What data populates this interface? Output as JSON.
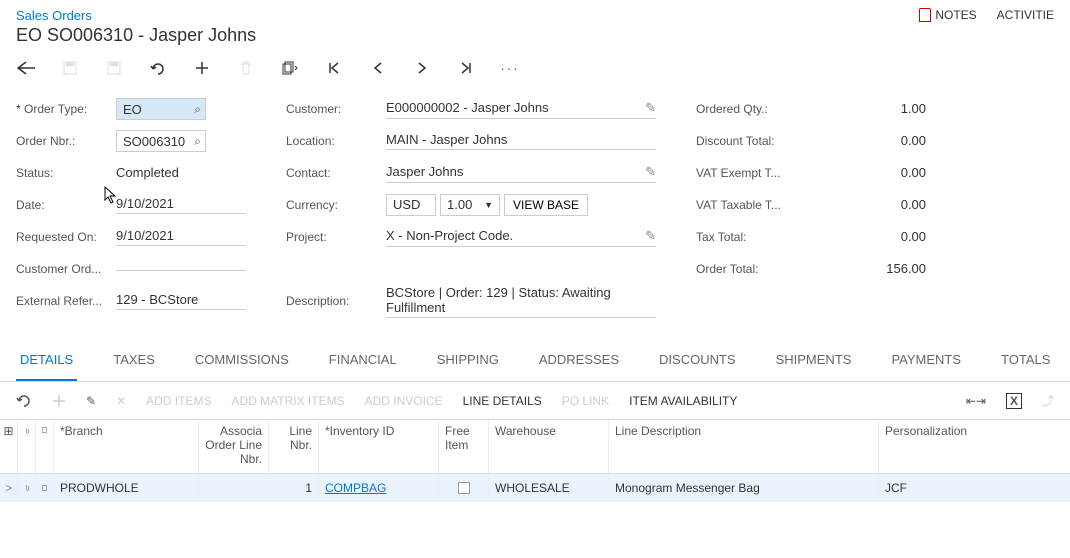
{
  "breadcrumb": "Sales Orders",
  "title": "EO SO006310 - Jasper Johns",
  "header_actions": {
    "notes": "NOTES",
    "activities": "ACTIVITIE"
  },
  "form": {
    "order_type": {
      "label": "Order Type:",
      "value": "EO"
    },
    "order_nbr": {
      "label": "Order Nbr.:",
      "value": "SO006310"
    },
    "status": {
      "label": "Status:",
      "value": "Completed"
    },
    "date": {
      "label": "Date:",
      "value": "9/10/2021"
    },
    "requested_on": {
      "label": "Requested On:",
      "value": "9/10/2021"
    },
    "customer_ord": {
      "label": "Customer Ord...",
      "value": ""
    },
    "external_ref": {
      "label": "External Refer...",
      "value": "129 - BCStore"
    },
    "customer": {
      "label": "Customer:",
      "value": "E000000002 - Jasper Johns"
    },
    "location": {
      "label": "Location:",
      "value": "MAIN - Jasper Johns"
    },
    "contact": {
      "label": "Contact:",
      "value": "Jasper Johns"
    },
    "currency": {
      "label": "Currency:",
      "code": "USD",
      "rate": "1.00",
      "btn": "VIEW BASE"
    },
    "project": {
      "label": "Project:",
      "value": "X - Non-Project Code."
    },
    "description": {
      "label": "Description:",
      "value": "BCStore | Order: 129 | Status: Awaiting Fulfillment"
    },
    "ordered_qty": {
      "label": "Ordered Qty.:",
      "value": "1.00"
    },
    "discount_total": {
      "label": "Discount Total:",
      "value": "0.00"
    },
    "vat_exempt": {
      "label": "VAT Exempt T...",
      "value": "0.00"
    },
    "vat_taxable": {
      "label": "VAT Taxable T...",
      "value": "0.00"
    },
    "tax_total": {
      "label": "Tax Total:",
      "value": "0.00"
    },
    "order_total": {
      "label": "Order Total:",
      "value": "156.00"
    }
  },
  "tabs": [
    "DETAILS",
    "TAXES",
    "COMMISSIONS",
    "FINANCIAL",
    "SHIPPING",
    "ADDRESSES",
    "DISCOUNTS",
    "SHIPMENTS",
    "PAYMENTS",
    "TOTALS"
  ],
  "grid_toolbar": {
    "add_items": "ADD ITEMS",
    "add_matrix": "ADD MATRIX ITEMS",
    "add_invoice": "ADD INVOICE",
    "line_details": "LINE DETAILS",
    "po_link": "PO LINK",
    "item_avail": "ITEM AVAILABILITY"
  },
  "grid": {
    "headers": {
      "branch": "*Branch",
      "assoc": "Associa Order Line Nbr.",
      "line": "Line Nbr.",
      "inv": "*Inventory ID",
      "free": "Free Item",
      "wh": "Warehouse",
      "desc": "Line Description",
      "pers": "Personalization"
    },
    "rows": [
      {
        "branch": "PRODWHOLE",
        "assoc": "",
        "line": "1",
        "inv": "COMPBAG",
        "free": false,
        "wh": "WHOLESALE",
        "desc": "Monogram Messenger Bag",
        "pers": "JCF"
      }
    ]
  }
}
